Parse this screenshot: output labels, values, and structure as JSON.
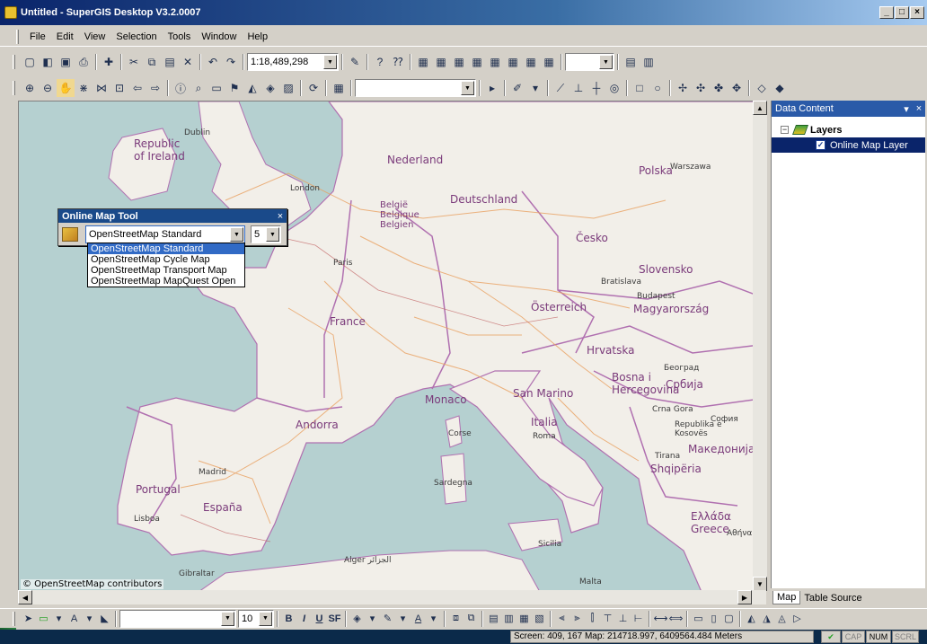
{
  "window": {
    "title": "Untitled - SuperGIS Desktop V3.2.0007",
    "minimize": "_",
    "maximize": "□",
    "close": "×"
  },
  "menu": [
    "File",
    "Edit",
    "View",
    "Selection",
    "Tools",
    "Window",
    "Help"
  ],
  "toolbar1": {
    "scale_value": "1:18,489,298",
    "blank_combo": ""
  },
  "toolbar2": {
    "layer_combo": ""
  },
  "online_map_tool": {
    "title": "Online Map Tool",
    "close": "×",
    "selected_map": "OpenStreetMap Standard",
    "zoom_level": "5",
    "options": [
      "OpenStreetMap Standard",
      "OpenStreetMap Cycle Map",
      "OpenStreetMap Transport Map",
      "OpenStreetMap MapQuest Open"
    ]
  },
  "map": {
    "attribution": "© OpenStreetMap contributors",
    "labels": {
      "dublin": "Dublin",
      "ireland": "Republic of Ireland",
      "london": "London",
      "paris": "Paris",
      "france": "France",
      "nederland": "Nederland",
      "belgien": "België Belgique Belgien",
      "deutschland": "Deutschland",
      "polska": "Polska",
      "warszawa": "Warszawa",
      "cesko": "Česko",
      "slovensko": "Slovensko",
      "bratislava": "Bratislava",
      "budapest": "Budapest",
      "magyarorszag": "Magyarország",
      "osterreich": "Österreich",
      "italia": "Italia",
      "roma": "Roma",
      "espana": "España",
      "madrid": "Madrid",
      "portugal": "Portugal",
      "lisboa": "Lisboa",
      "andorra": "Andorra",
      "monaco": "Monaco",
      "san_marino": "San Marino",
      "hrvatska": "Hrvatska",
      "bosna": "Bosna i Hercegovina",
      "srbija": "Србија",
      "beograd": "Београд",
      "crna_gora": "Crna Gora",
      "kosovo": "Republika e Kosovës",
      "makedonija": "Македонија",
      "sofia": "София",
      "tirana": "Tirana",
      "shqiperia": "Shqipëria",
      "greece": "Ελλάδα Greece",
      "athens": "Αθήνα",
      "malta": "Malta",
      "alger": "Alger الجزائر",
      "gibraltar": "Gibraltar",
      "sicilia": "Sicilia",
      "sardegna": "Sardegna",
      "corse": "Corse"
    }
  },
  "data_content": {
    "title": "Data Content",
    "pin": "▾",
    "close": "×",
    "expander": "−",
    "layers_label": "Layers",
    "layer_item": "Online Map Layer",
    "layer_checked": "✓",
    "tabs": [
      "Map",
      "Table Source"
    ]
  },
  "draw_toolbar": {
    "font_combo": "",
    "font_size": "10",
    "bold": "B",
    "italic": "I",
    "underline": "U",
    "strike": "SF"
  },
  "status": {
    "coords": "Screen: 409, 167  Map: 214718.997, 6409564.484 Meters",
    "indicators": [
      "CAP",
      "NUM",
      "SCRL"
    ]
  },
  "colors": {
    "title_start": "#0a246a",
    "title_end": "#a6caf0",
    "map_water": "#b5d0d0",
    "map_land": "#f2efe9",
    "border_purple": "#b070b0",
    "selection": "#316ac5"
  }
}
